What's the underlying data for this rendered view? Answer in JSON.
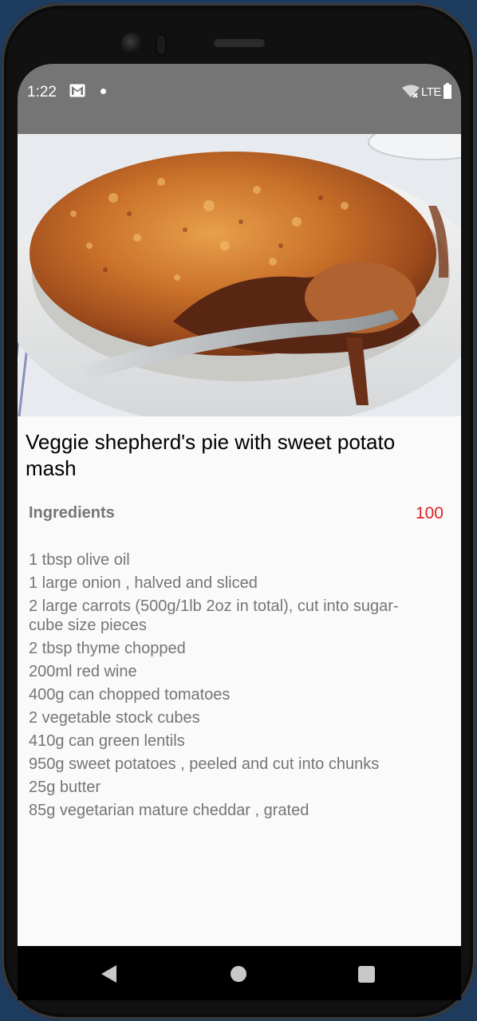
{
  "status_bar": {
    "time": "1:22",
    "network": "LTE",
    "icons": [
      "gmail-icon",
      "notification-dot-icon",
      "wifi-icon",
      "battery-icon"
    ]
  },
  "recipe": {
    "image_icon": "shepherds-pie-photo",
    "title": "Veggie shepherd's pie with sweet potato mash",
    "ingredients_label": "Ingredients",
    "ingredients_count": "100",
    "ingredients": [
      "1 tbsp olive oil",
      "1 large onion , halved and sliced",
      "2 large carrots (500g/1lb 2oz in total), cut into sugar-cube size pieces",
      "2 tbsp thyme chopped",
      "200ml red wine",
      "400g can chopped tomatoes",
      "2 vegetable stock cubes",
      "410g can green lentils",
      "950g sweet potatoes , peeled and cut into chunks",
      "25g butter",
      "85g vegetarian mature cheddar , grated"
    ]
  },
  "nav_bar": {
    "icons": [
      "back-icon",
      "home-icon",
      "recents-icon"
    ]
  },
  "colors": {
    "status_bar_bg": "#757575",
    "content_bg": "#fafafa",
    "count_accent": "#e02222",
    "muted_text": "#757575"
  }
}
